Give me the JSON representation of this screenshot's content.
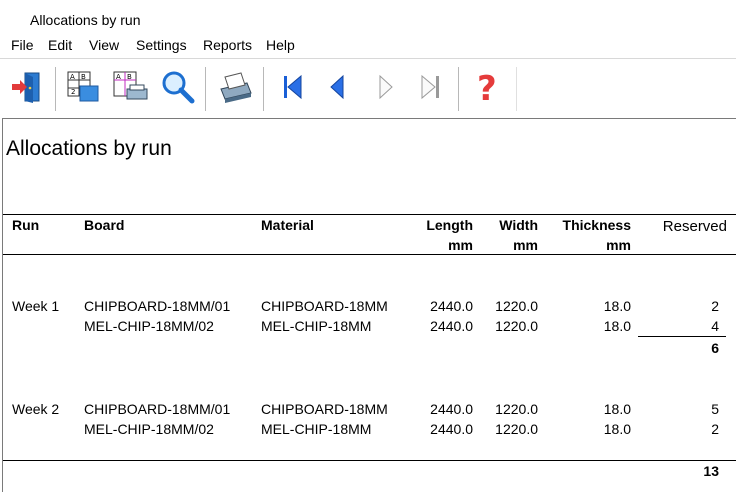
{
  "window": {
    "title": "Allocations by run"
  },
  "menu": [
    "File",
    "Edit",
    "View",
    "Settings",
    "Reports",
    "Help"
  ],
  "toolbar": {
    "icons": [
      "exit-icon",
      "layout-grid-icon",
      "print-layout-icon",
      "search-icon",
      "printer-icon",
      "first-page-icon",
      "previous-page-icon",
      "next-page-icon",
      "last-page-icon",
      "help-icon"
    ],
    "colors": {
      "nav_active": "#1a5fd6",
      "nav_disabled": "#9a9a9a",
      "help": "#e53b3b"
    }
  },
  "report": {
    "title": "Allocations by run",
    "headers": {
      "run": "Run",
      "board": "Board",
      "material": "Material",
      "length": "Length",
      "length_unit": "mm",
      "width": "Width",
      "width_unit": "mm",
      "thickness": "Thickness",
      "thickness_unit": "mm",
      "reserved": "Reserved"
    },
    "groups": [
      {
        "run": "Week 1",
        "rows": [
          {
            "board": "CHIPBOARD-18MM/01",
            "material": "CHIPBOARD-18MM",
            "length": "2440.0",
            "width": "1220.0",
            "thickness": "18.0",
            "reserved": "2"
          },
          {
            "board": "MEL-CHIP-18MM/02",
            "material": "MEL-CHIP-18MM",
            "length": "2440.0",
            "width": "1220.0",
            "thickness": "18.0",
            "reserved": "4"
          }
        ],
        "subtotal": "6"
      },
      {
        "run": "Week 2",
        "rows": [
          {
            "board": "CHIPBOARD-18MM/01",
            "material": "CHIPBOARD-18MM",
            "length": "2440.0",
            "width": "1220.0",
            "thickness": "18.0",
            "reserved": "5"
          },
          {
            "board": "MEL-CHIP-18MM/02",
            "material": "MEL-CHIP-18MM",
            "length": "2440.0",
            "width": "1220.0",
            "thickness": "18.0",
            "reserved": "2"
          }
        ]
      }
    ],
    "grand_total": "13"
  }
}
